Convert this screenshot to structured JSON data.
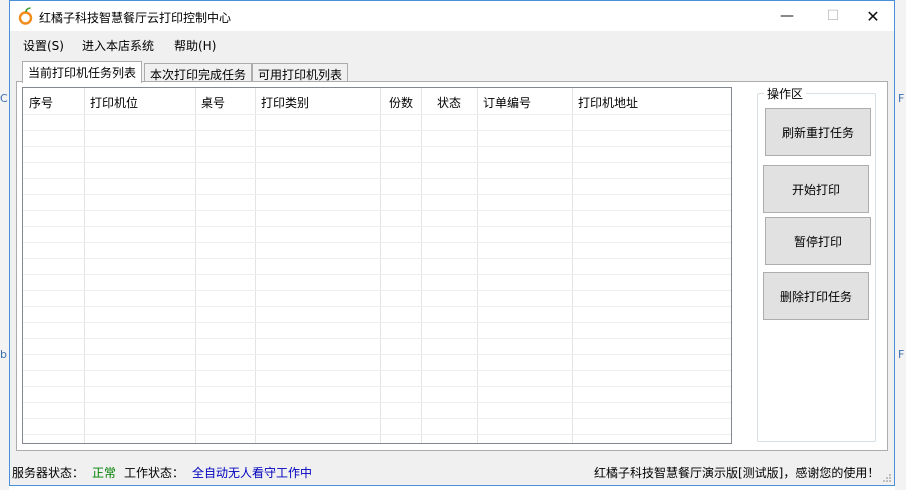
{
  "background": {
    "left_glyph_1": "C",
    "left_glyph_2": "b",
    "right_glyph_1": "F",
    "right_glyph_2": "F"
  },
  "window": {
    "title": "红橘子科技智慧餐厅云打印控制中心",
    "controls": {
      "minimize": "—",
      "maximize": "☐",
      "close": "✕"
    }
  },
  "menu": {
    "settings": "设置(S)",
    "enter_store": "进入本店系统",
    "help": "帮助(H)"
  },
  "tabs": {
    "current_tasks": "当前打印机任务列表",
    "completed_tasks": "本次打印完成任务",
    "printer_list": "可用打印机列表"
  },
  "table": {
    "columns": [
      "序号",
      "打印机位",
      "桌号",
      "打印类别",
      "份数",
      "状态",
      "订单编号",
      "打印机地址"
    ],
    "rows": []
  },
  "operations": {
    "title": "操作区",
    "refresh_reprint": "刷新重打任务",
    "start_print": "开始打印",
    "pause_print": "暂停打印",
    "delete_task": "删除打印任务"
  },
  "status": {
    "server_label": "服务器状态：",
    "server_value": "正常",
    "work_label": "工作状态：",
    "work_value": "全自动无人看守工作中",
    "footer_message": "红橘子科技智慧餐厅演示版[测试版]，感谢您的使用！"
  },
  "colors": {
    "server_ok": "#008000",
    "work_status": "#0000c0",
    "window_border": "#4a90d9",
    "icon_orange": "#f28c1a"
  }
}
